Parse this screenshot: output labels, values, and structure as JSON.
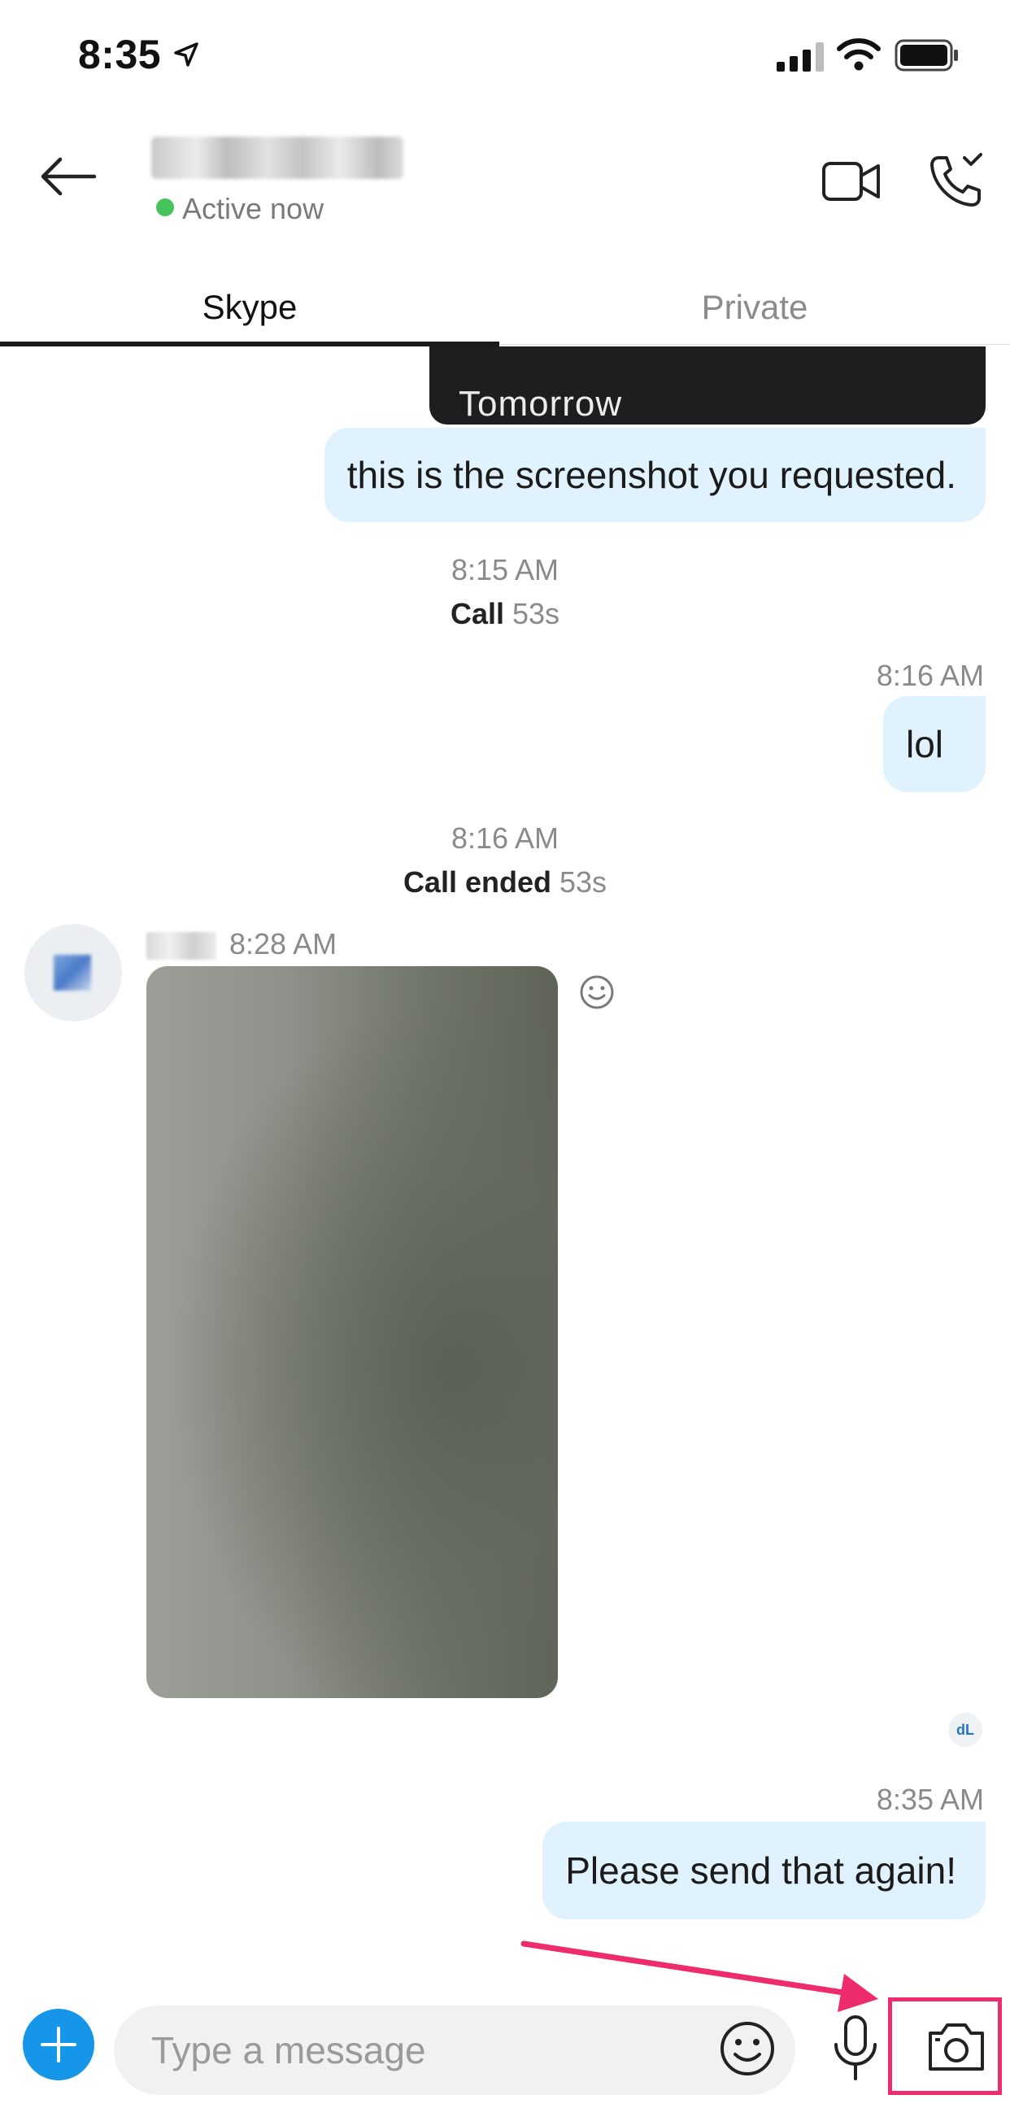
{
  "status_bar": {
    "time": "8:35",
    "icons": [
      "location-arrow-icon",
      "signal-icon",
      "wifi-icon",
      "battery-icon"
    ]
  },
  "header": {
    "back_icon": "back-arrow-icon",
    "presence": "Active now",
    "presence_color": "#46c35b",
    "actions": [
      "video-call-icon",
      "audio-call-icon"
    ]
  },
  "tabs": [
    {
      "label": "Skype",
      "selected": true
    },
    {
      "label": "Private",
      "selected": false
    }
  ],
  "messages": {
    "card_caption": "Tomorrow",
    "msg1": "this is the screenshot you requested.",
    "time1": "8:15 AM",
    "call_label": "Call",
    "call_duration": "53s",
    "time2": "8:16 AM",
    "msg2": "lol",
    "time3": "8:16 AM",
    "call_ended_label": "Call ended",
    "call_ended_duration": "53s",
    "incoming_time": "8:28 AM",
    "seen_badge": "dL",
    "time4": "8:35 AM",
    "msg3": "Please send that again!"
  },
  "composer": {
    "placeholder": "Type a message",
    "buttons": [
      "add-icon",
      "emoji-icon",
      "microphone-icon",
      "camera-icon"
    ]
  },
  "colors": {
    "outgoing_bubble": "#dff2fd",
    "accent_blue": "#1596e8",
    "annotation": "#ee2c6d"
  }
}
